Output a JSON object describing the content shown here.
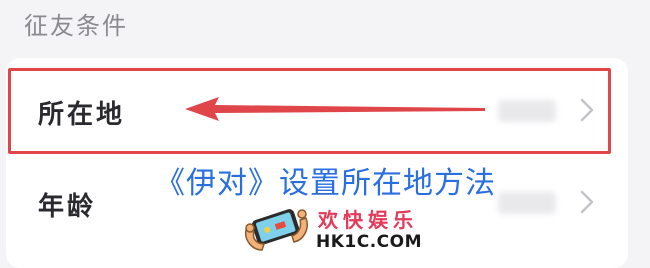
{
  "section": {
    "title": "征友条件"
  },
  "rows": [
    {
      "label": "所在地",
      "value_blurred": true
    },
    {
      "label": "年龄",
      "value_blurred": true
    }
  ],
  "overlay": {
    "title": "《伊对》设置所在地方法",
    "title_color": "#2a6fe0"
  },
  "watermark": {
    "name": "欢快娱乐",
    "url": "HK1C.COM",
    "logo_icon": "hands-holding-phone-icon"
  },
  "annotation": {
    "highlight_color": "#e0454a",
    "arrow_icon": "left-arrow-icon"
  }
}
